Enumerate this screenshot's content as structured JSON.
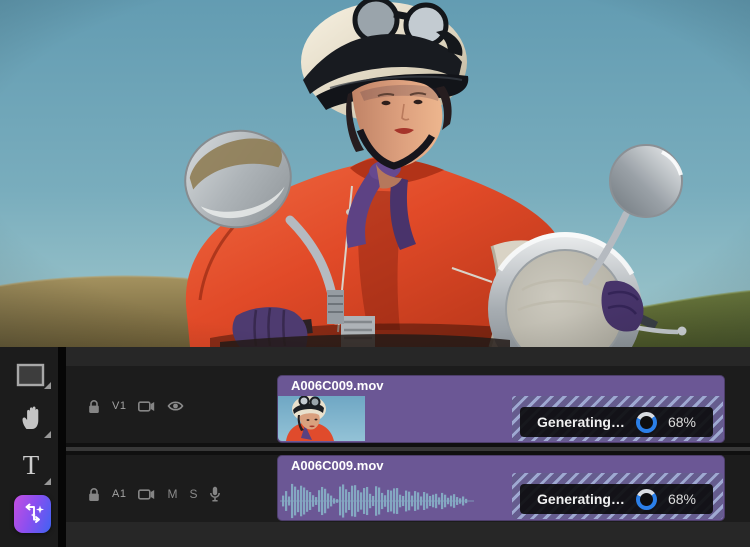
{
  "monitor": {
    "description": "Woman in cream helmet with goggles and red leather jacket on a chrome scooter, blue sky and grassy hills"
  },
  "toolbar": {
    "tools": [
      {
        "id": "rectangle-tool",
        "label": "Rectangle tool",
        "has_flyout": true
      },
      {
        "id": "hand-tool",
        "label": "Hand tool",
        "has_flyout": true
      },
      {
        "id": "type-tool",
        "label": "Type tool",
        "glyph": "T",
        "has_flyout": true
      },
      {
        "id": "generative-extend-tool",
        "label": "Generative Extend tool",
        "has_flyout": false
      }
    ]
  },
  "timeline": {
    "tracks": [
      {
        "type": "video",
        "header": {
          "lock_icon": "lock-icon",
          "label": "V1",
          "icons": [
            "track-targeting-icon",
            "eye-icon"
          ]
        },
        "clip": {
          "name": "A006C009.mov",
          "generating_label": "Generating…",
          "progress_text": "68%",
          "progress_percent": 68
        }
      },
      {
        "type": "audio",
        "header": {
          "lock_icon": "lock-icon",
          "label": "A1",
          "icons": [
            "track-targeting-icon"
          ],
          "mute": "M",
          "solo": "S",
          "mic_icon": "microphone-icon"
        },
        "clip": {
          "name": "A006C009.mov",
          "generating_label": "Generating…",
          "progress_text": "68%",
          "progress_percent": 68
        }
      }
    ]
  },
  "colors": {
    "clip_purple": "#6b5795",
    "stripe_light": "#9fa9d2",
    "stripe_dark": "#655c8e",
    "progress_blue": "#2b7fe8",
    "progress_track": "#d9dce1",
    "waveform": "#84a8c2",
    "badge_bg": "#0e0e10",
    "gen_tool_gradient": [
      "#c44fe0",
      "#3f63f2"
    ]
  },
  "waveform_amplitudes": [
    0.3,
    0.55,
    0.25,
    0.95,
    0.8,
    0.62,
    0.85,
    0.75,
    0.6,
    0.5,
    0.32,
    0.22,
    0.6,
    0.78,
    0.68,
    0.42,
    0.3,
    0.15,
    0.1,
    0.8,
    0.92,
    0.65,
    0.5,
    0.85,
    0.88,
    0.6,
    0.48,
    0.72,
    0.78,
    0.4,
    0.28,
    0.82,
    0.75,
    0.45,
    0.32,
    0.62,
    0.58,
    0.7,
    0.72,
    0.35,
    0.28,
    0.58,
    0.52,
    0.3,
    0.55,
    0.48,
    0.25,
    0.5,
    0.42,
    0.28,
    0.35,
    0.4,
    0.2,
    0.45,
    0.35,
    0.18,
    0.3,
    0.38,
    0.22,
    0.15,
    0.25,
    0.12
  ]
}
